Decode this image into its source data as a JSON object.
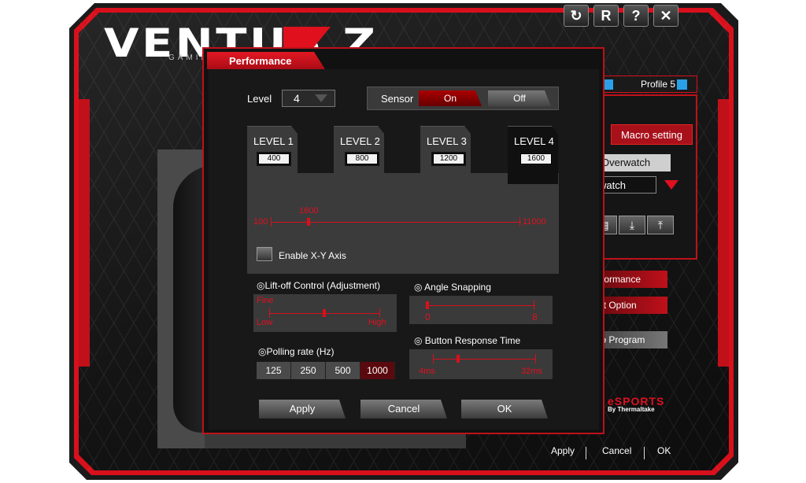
{
  "app": {
    "logo": "VENTUS Z",
    "logo_sub": "GAMING",
    "top_buttons": [
      "↻",
      "R",
      "?",
      "✕"
    ]
  },
  "profile": {
    "label": "Profile 5"
  },
  "macro": {
    "tab_label": "Macro setting",
    "game_value": "Overwatch",
    "game_select": "watch"
  },
  "side_menu": {
    "performance": "rformance",
    "light_option": "ht Option",
    "program": "to Program"
  },
  "brand": {
    "name": "eSPORTS",
    "sub": "By Thermaltake"
  },
  "bottom": {
    "apply": "Apply",
    "cancel": "Cancel",
    "ok": "OK"
  },
  "dialog": {
    "title": "Performance",
    "level_label": "Level",
    "level_value": "4",
    "sensor_label": "Sensor",
    "sensor_on": "On",
    "sensor_off": "Off",
    "levels": [
      {
        "name": "LEVEL 1",
        "dpi": "400"
      },
      {
        "name": "LEVEL 2",
        "dpi": "800"
      },
      {
        "name": "LEVEL 3",
        "dpi": "1200"
      },
      {
        "name": "LEVEL 4",
        "dpi": "1600"
      }
    ],
    "active_level": 4,
    "dpi_slider": {
      "min": "100",
      "max": "11000",
      "current": "1600",
      "current_value": 1600,
      "range": [
        100,
        11000
      ]
    },
    "xy_axis": "Enable X-Y Axis",
    "lift_off": {
      "title": "◎Lift-off Control (Adjustment)",
      "fine": "Fine",
      "low": "Low",
      "high": "High",
      "value": 0.5
    },
    "angle_snapping": {
      "title": "◎ Angle Snapping",
      "min": "0",
      "max": "8",
      "value": 0
    },
    "polling": {
      "title": "◎Polling rate (Hz)",
      "options": [
        "125",
        "250",
        "500",
        "1000"
      ],
      "selected": "1000"
    },
    "button_response": {
      "title": "◎ Button Response Time",
      "min": "4ms",
      "max": "32ms",
      "value": 0.2
    },
    "apply": "Apply",
    "cancel": "Cancel",
    "ok": "OK"
  }
}
